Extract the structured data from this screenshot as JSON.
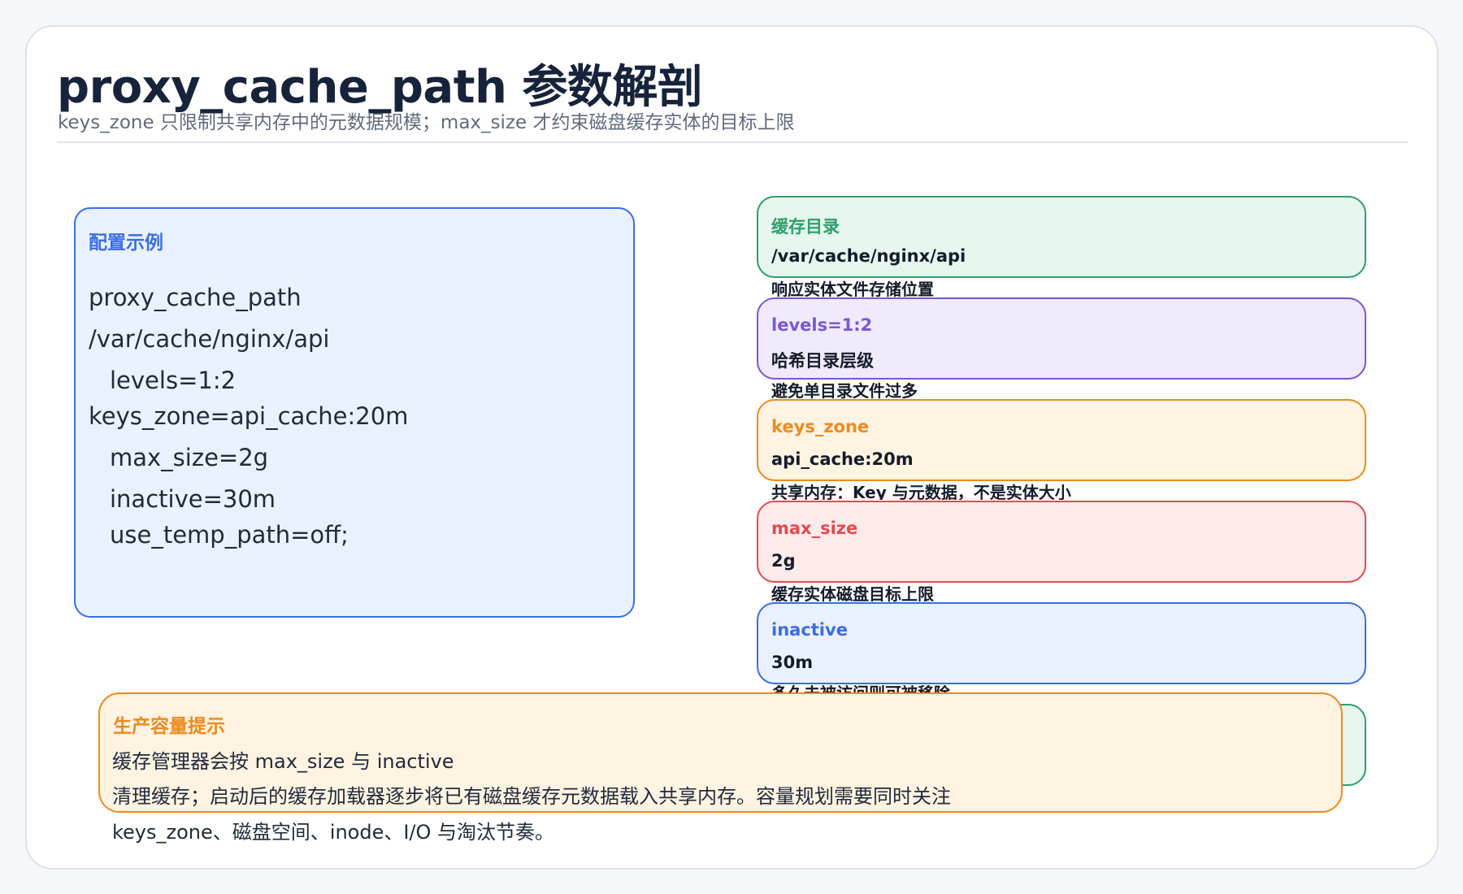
{
  "header": {
    "title": "proxy_cache_path 参数解剖",
    "subtitle": "keys_zone 只限制共享内存中的元数据规模；max_size 才约束磁盘缓存实体的目标上限"
  },
  "config_example": {
    "title": "配置示例",
    "lines": [
      "proxy_cache_path",
      "/var/cache/nginx/api",
      "levels=1:2",
      "keys_zone=api_cache:20m",
      "max_size=2g",
      "inactive=30m",
      "use_temp_path=off;"
    ]
  },
  "params": [
    {
      "label": "缓存目录",
      "value": "/var/cache/nginx/api",
      "desc": "响应实体文件存储位置",
      "color": "#2e9f6b"
    },
    {
      "label": "levels=1:2",
      "value": "哈希目录层级",
      "desc": "避免单目录文件过多",
      "color": "#7a56d6"
    },
    {
      "label": "keys_zone",
      "value": "api_cache:20m",
      "desc": "共享内存：Key 与元数据，不是实体大小",
      "color": "#ef8a1f"
    },
    {
      "label": "max_size",
      "value": "2g",
      "desc": "缓存实体磁盘目标上限",
      "color": "#df4c4f"
    },
    {
      "label": "inactive",
      "value": "30m",
      "desc": "多久未被访问则可被移除",
      "color": "#3a6ee8"
    }
  ],
  "production_tip": {
    "title": "生产容量提示",
    "lines": [
      "缓存管理器会按 max_size 与 inactive",
      "清理缓存；启动后的缓存加载器逐步将已有磁盘缓存元数据载入共享内存。容量规划需要同时关注",
      "keys_zone、磁盘空间、inode、I/O 与淘汰节奏。"
    ]
  }
}
